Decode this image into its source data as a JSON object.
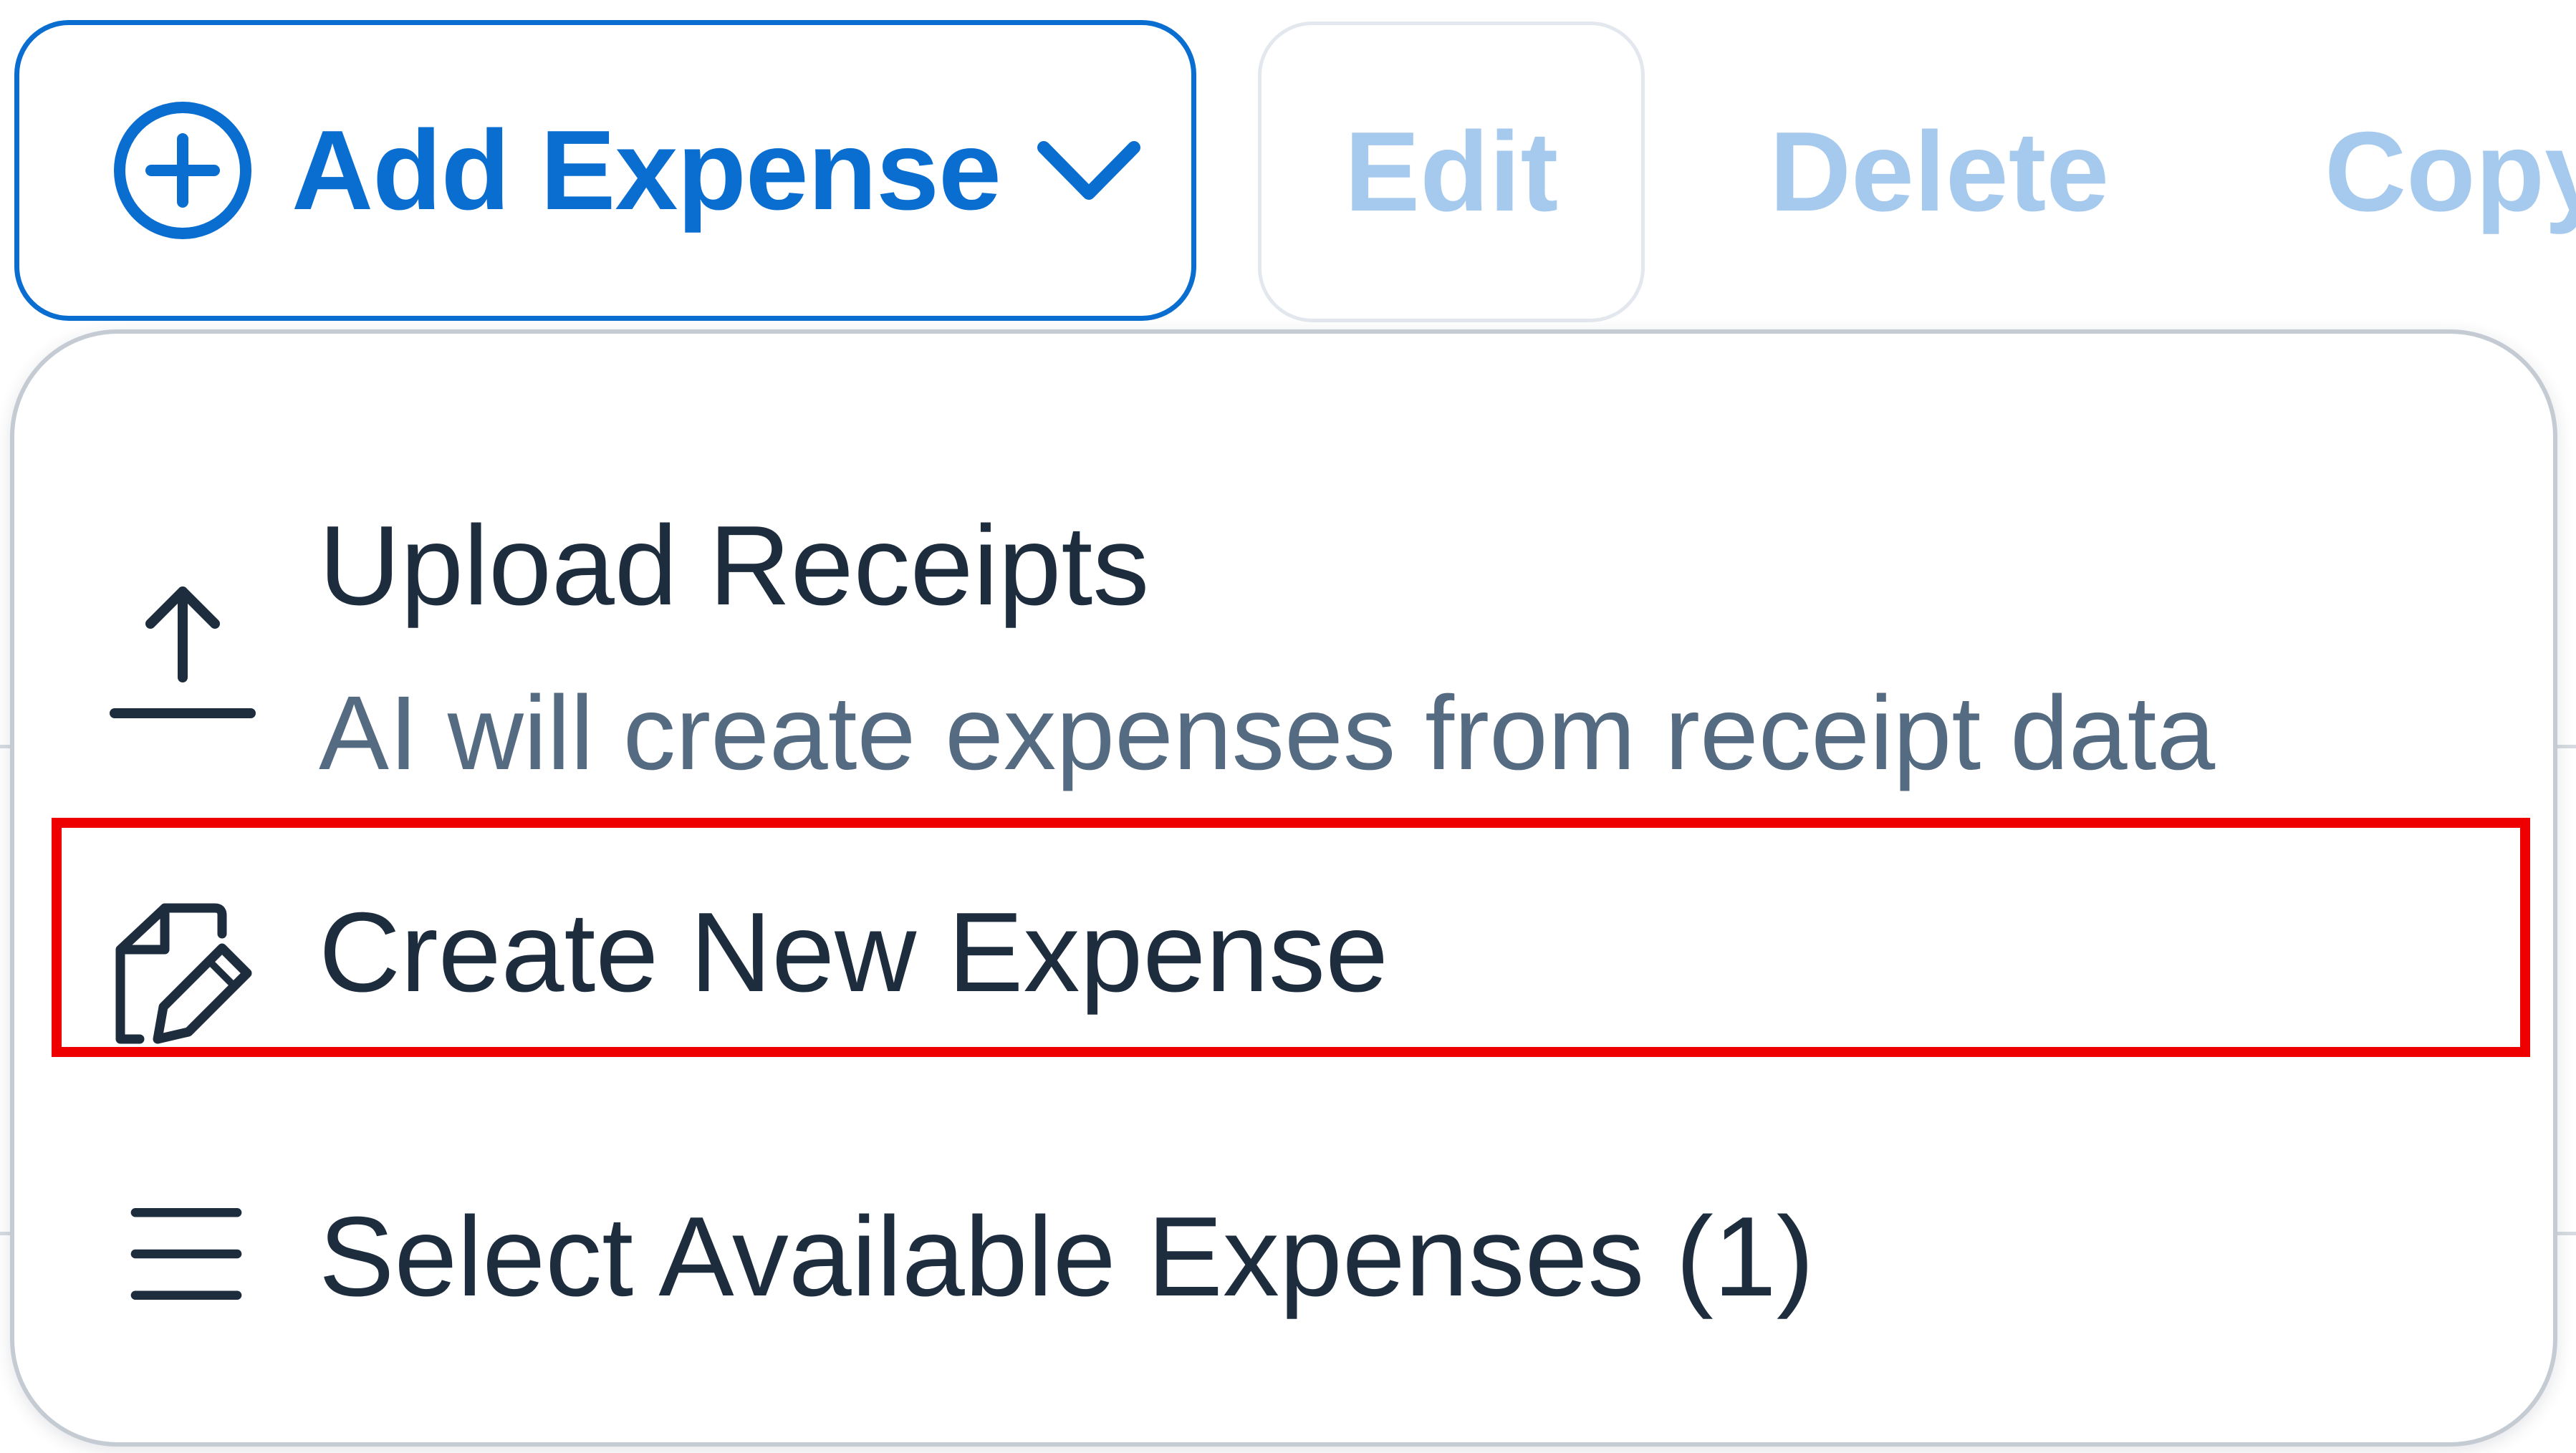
{
  "toolbar": {
    "add_expense_label": "Add Expense",
    "edit_label": "Edit",
    "delete_label": "Delete",
    "copy_label": "Copy"
  },
  "menu": {
    "items": [
      {
        "icon": "upload-icon",
        "title": "Upload Receipts",
        "subtitle": "AI will create expenses from receipt data"
      },
      {
        "icon": "document-edit-icon",
        "title": "Create New Expense",
        "highlighted": true
      },
      {
        "icon": "list-icon",
        "title": "Select Available Expenses (1)"
      }
    ]
  },
  "colors": {
    "accent": "#0a6ed1",
    "disabled_text": "#a6c9ee",
    "menu_text": "#1d2d3e",
    "menu_subtext": "#556b82",
    "highlight": "#ee0000"
  }
}
